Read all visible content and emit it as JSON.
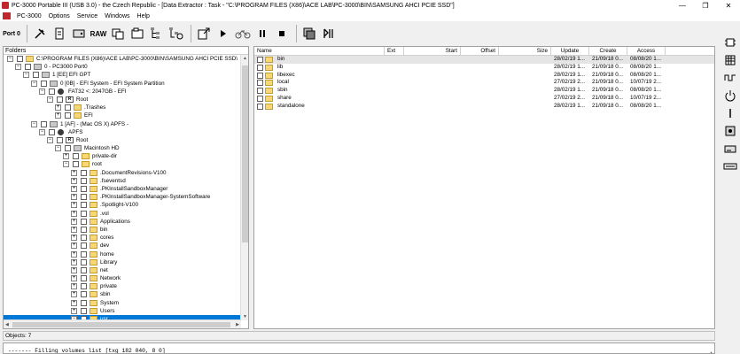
{
  "window": {
    "title": "PC-3000 Portable III (USB 3.0) - the Czech Republic - [Data Extractor : Task - \"C:\\PROGRAM FILES (X86)\\ACE LAB\\PC-3000\\BIN\\SAMSUNG AHCI PCIE SSD\"]",
    "minimize": "—",
    "maximize": "❐",
    "close": "✕"
  },
  "menu": [
    "PC-3000",
    "Options",
    "Service",
    "Windows",
    "Help"
  ],
  "toolbar": {
    "port_label": "Port 0",
    "raw_label": "RAW"
  },
  "folders": {
    "header": "Folders",
    "rows": [
      {
        "indent": 0,
        "exp": "−",
        "icon": "folder",
        "label": "C:\\PROGRAM FILES (X86)\\ACE LAB\\PC-3000\\BIN\\SAMSUNG AHCI PCIE SSD\\"
      },
      {
        "indent": 1,
        "exp": "−",
        "icon": "disk",
        "label": "0 - PC3000 Port0"
      },
      {
        "indent": 2,
        "exp": "−",
        "icon": "disk",
        "label": "1 [EE] EFI GPT"
      },
      {
        "indent": 3,
        "exp": "−",
        "icon": "disk",
        "label": "0 [0B] - EFI System - EFI System Partition"
      },
      {
        "indent": 4,
        "exp": "−",
        "icon": "part",
        "label": "FAT32 <: 2047GB - EFI"
      },
      {
        "indent": 5,
        "exp": "−",
        "icon": "root",
        "label": "Root"
      },
      {
        "indent": 6,
        "exp": "+",
        "icon": "folder",
        "label": ".Trashes"
      },
      {
        "indent": 6,
        "exp": "+",
        "icon": "folder",
        "label": "EFI"
      },
      {
        "indent": 3,
        "exp": "−",
        "icon": "disk",
        "label": "1 [AF] - (Mac OS X) APFS -"
      },
      {
        "indent": 4,
        "exp": "−",
        "icon": "part",
        "label": "APFS"
      },
      {
        "indent": 5,
        "exp": "−",
        "icon": "root",
        "label": "Root"
      },
      {
        "indent": 6,
        "exp": "−",
        "icon": "disk",
        "label": "Macintosh HD"
      },
      {
        "indent": 7,
        "exp": "+",
        "icon": "folder",
        "label": "private-dir"
      },
      {
        "indent": 7,
        "exp": "−",
        "icon": "folder",
        "label": "root"
      },
      {
        "indent": 8,
        "exp": "+",
        "icon": "folder",
        "label": ".DocumentRevisions-V100"
      },
      {
        "indent": 8,
        "exp": "+",
        "icon": "folder",
        "label": ".fseventsd"
      },
      {
        "indent": 8,
        "exp": "+",
        "icon": "folder",
        "label": ".PKInstallSandboxManager"
      },
      {
        "indent": 8,
        "exp": "+",
        "icon": "folder",
        "label": ".PKInstallSandboxManager-SystemSoftware"
      },
      {
        "indent": 8,
        "exp": "+",
        "icon": "folder",
        "label": ".Spotlight-V100"
      },
      {
        "indent": 8,
        "exp": "+",
        "icon": "folder",
        "label": ".vol"
      },
      {
        "indent": 8,
        "exp": "+",
        "icon": "folder",
        "label": "Applications"
      },
      {
        "indent": 8,
        "exp": "+",
        "icon": "folder",
        "label": "bin"
      },
      {
        "indent": 8,
        "exp": "+",
        "icon": "folder",
        "label": "cores"
      },
      {
        "indent": 8,
        "exp": "+",
        "icon": "folder",
        "label": "dev"
      },
      {
        "indent": 8,
        "exp": "+",
        "icon": "folder",
        "label": "home"
      },
      {
        "indent": 8,
        "exp": "+",
        "icon": "folder",
        "label": "Library"
      },
      {
        "indent": 8,
        "exp": "+",
        "icon": "folder",
        "label": "net"
      },
      {
        "indent": 8,
        "exp": "+",
        "icon": "folder",
        "label": "Network"
      },
      {
        "indent": 8,
        "exp": "+",
        "icon": "folder",
        "label": "private"
      },
      {
        "indent": 8,
        "exp": "+",
        "icon": "folder",
        "label": "sbin"
      },
      {
        "indent": 8,
        "exp": "+",
        "icon": "folder",
        "label": "System"
      },
      {
        "indent": 8,
        "exp": "+",
        "icon": "folder",
        "label": "Users"
      },
      {
        "indent": 8,
        "exp": "−",
        "icon": "folder",
        "label": "usr",
        "selected": true
      }
    ]
  },
  "files": {
    "columns": {
      "name": "Name",
      "ext": "Ext",
      "start": "Start",
      "offset": "Offset",
      "size": "Size",
      "update": "Update",
      "create": "Create",
      "access": "Access"
    },
    "rows": [
      {
        "name": "bin",
        "update": "28/02/19 1...",
        "create": "21/09/18 0...",
        "access": "08/08/20 1..."
      },
      {
        "name": "lib",
        "update": "28/02/19 1...",
        "create": "21/09/18 0...",
        "access": "08/08/20 1..."
      },
      {
        "name": "libexec",
        "update": "28/02/19 1...",
        "create": "21/09/18 0...",
        "access": "08/08/20 1..."
      },
      {
        "name": "local",
        "update": "27/02/19 2...",
        "create": "21/09/18 0...",
        "access": "10/07/19 2..."
      },
      {
        "name": "sbin",
        "update": "28/02/19 1...",
        "create": "21/09/18 0...",
        "access": "08/08/20 1..."
      },
      {
        "name": "share",
        "update": "27/02/19 2...",
        "create": "21/09/18 0...",
        "access": "10/07/19 2..."
      },
      {
        "name": "standalone",
        "update": "28/02/19 1...",
        "create": "21/09/18 0...",
        "access": "08/08/20 1..."
      }
    ]
  },
  "status": {
    "objects": "Objects: 7"
  },
  "log": {
    "line": "------- Filling volumes list [txg     182 040,  8    0]"
  }
}
